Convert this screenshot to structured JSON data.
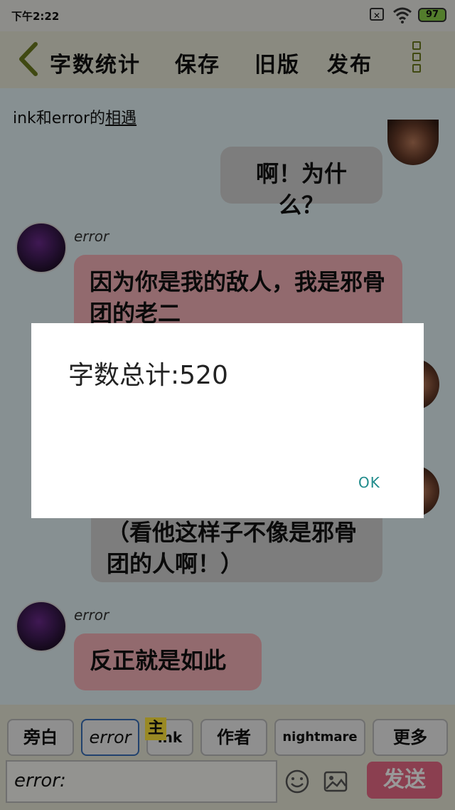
{
  "status_bar": {
    "time": "下午2:22",
    "battery": "97"
  },
  "top_bar": {
    "word_count": "字数统计",
    "save": "保存",
    "old_version": "旧版",
    "publish": "发布"
  },
  "chat": {
    "title_prefix": "ink和error的",
    "title_suffix": "相遇",
    "messages": [
      {
        "side": "right",
        "text": "啊！为什么？"
      },
      {
        "side": "left",
        "name": "error",
        "text": "因为你是我的敌人，我是邪骨团的老二"
      },
      {
        "side": "right",
        "text": "（看他这样子不像是邪骨团的人啊！）"
      },
      {
        "side": "left",
        "name": "error",
        "text": "反正就是如此"
      }
    ]
  },
  "dialog": {
    "message": "字数总计:520",
    "ok": "OK"
  },
  "role_buttons": [
    {
      "label": "旁白"
    },
    {
      "label": "error"
    },
    {
      "label": "ink",
      "badge": "主"
    },
    {
      "label": "作者"
    },
    {
      "label": "nightmare"
    },
    {
      "label": "更多"
    }
  ],
  "input": {
    "value": "error:"
  },
  "send_label": "发送",
  "icons": {
    "back": "chevron-left-icon",
    "more": "more-vertical-icon",
    "emoji": "smiley-icon",
    "image": "image-icon",
    "wifi": "wifi-icon",
    "sim": "sim-icon"
  },
  "colors": {
    "send_button": "#e86a86",
    "left_bubble": "#f4b1b8",
    "right_bubble": "#d1d1d1",
    "selected_role_border": "#3a6fb8",
    "ok_text": "#1f8b8b"
  }
}
